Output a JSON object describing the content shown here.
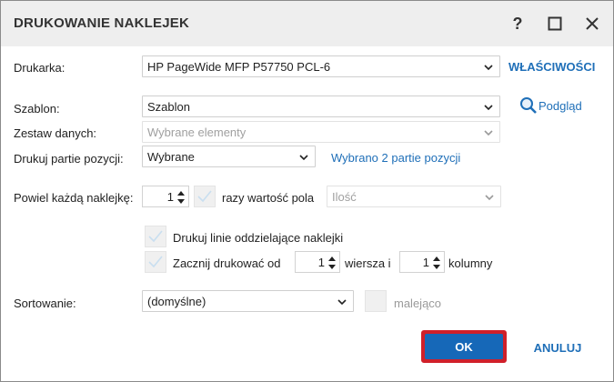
{
  "dialog": {
    "title": "DRUKOWANIE NAKLEJEK",
    "help_label": "?"
  },
  "printer": {
    "label": "Drukarka:",
    "value": "HP PageWide MFP P57750 PCL-6",
    "properties_link": "WŁAŚCIWOŚCI"
  },
  "template": {
    "label": "Szablon:",
    "value": "Szablon",
    "preview_link": "Podgląd"
  },
  "dataset": {
    "label": "Zestaw danych:",
    "value": "Wybrane elementy"
  },
  "batches": {
    "label": "Drukuj partie pozycji:",
    "value": "Wybrane",
    "selection_link": "Wybrano 2 partie pozycji"
  },
  "repeat": {
    "label": "Powiel każdą naklejkę:",
    "count": "1",
    "times_label": "razy wartość pola",
    "field_value": "Ilość"
  },
  "separator_lines": {
    "label": "Drukuj linie oddzielające naklejki",
    "checked": true
  },
  "start_position": {
    "label": "Zacznij drukować od",
    "row_value": "1",
    "row_label": "wiersza i",
    "column_value": "1",
    "column_label": "kolumny",
    "checked": true
  },
  "sorting": {
    "label": "Sortowanie:",
    "value": "(domyślne)",
    "descending_label": "malejąco",
    "descending_checked": false
  },
  "buttons": {
    "ok": "OK",
    "cancel": "ANULUJ"
  },
  "colors": {
    "link": "#1f6fb8",
    "primary": "#1668b8",
    "highlight": "#d0202a",
    "titlebar": "#eeeeee"
  }
}
